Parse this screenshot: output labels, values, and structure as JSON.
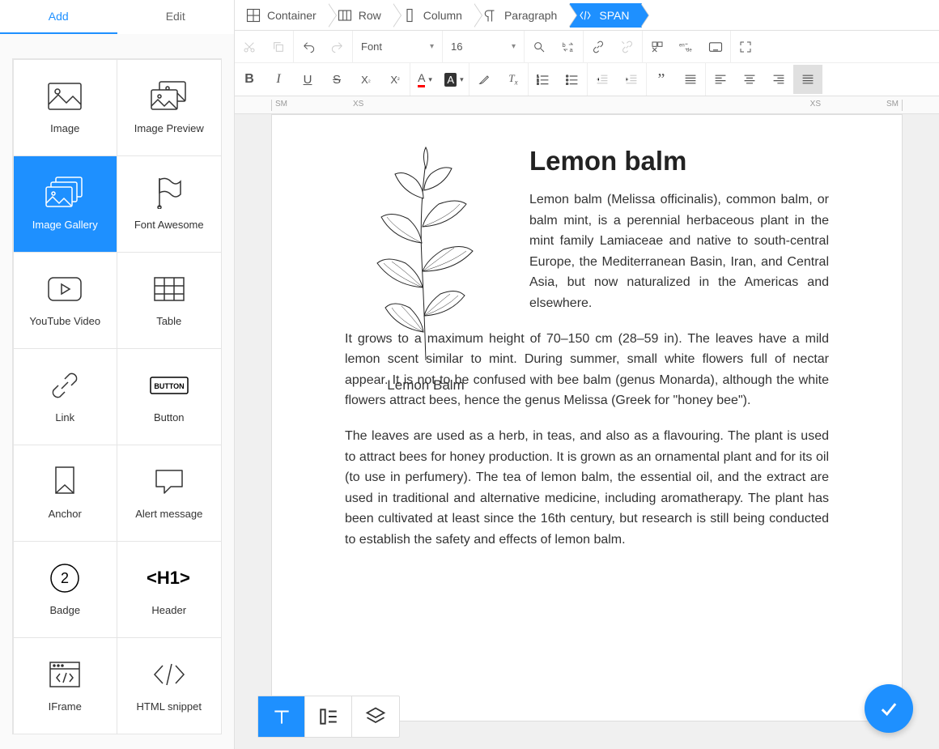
{
  "sidebar": {
    "tabs": {
      "add": "Add",
      "edit": "Edit"
    },
    "tiles": [
      {
        "label": "Image",
        "icon": "image-icon"
      },
      {
        "label": "Image Preview",
        "icon": "image-preview-icon"
      },
      {
        "label": "Image Gallery",
        "icon": "image-gallery-icon",
        "active": true
      },
      {
        "label": "Font Awesome",
        "icon": "flag-icon"
      },
      {
        "label": "YouTube Video",
        "icon": "youtube-icon"
      },
      {
        "label": "Table",
        "icon": "table-icon"
      },
      {
        "label": "Link",
        "icon": "link-icon"
      },
      {
        "label": "Button",
        "icon": "button-icon"
      },
      {
        "label": "Anchor",
        "icon": "anchor-icon"
      },
      {
        "label": "Alert message",
        "icon": "alert-icon"
      },
      {
        "label": "Badge",
        "icon": "badge-icon"
      },
      {
        "label": "Header",
        "icon": "header-icon"
      },
      {
        "label": "IFrame",
        "icon": "iframe-icon"
      },
      {
        "label": "HTML snippet",
        "icon": "html-snippet-icon"
      }
    ]
  },
  "breadcrumb": [
    {
      "label": "Container",
      "icon": "container-icon"
    },
    {
      "label": "Row",
      "icon": "row-icon"
    },
    {
      "label": "Column",
      "icon": "column-icon"
    },
    {
      "label": "Paragraph",
      "icon": "paragraph-icon"
    },
    {
      "label": "SPAN",
      "icon": "span-icon",
      "active": true
    }
  ],
  "toolbar": {
    "font_label": "Font",
    "font_size": "16"
  },
  "ruler": {
    "sm": "SM",
    "xs": "XS"
  },
  "document": {
    "image_caption": "Lemon Balm",
    "title": "Lemon balm",
    "p1": "Lemon balm (Melissa officinalis), common balm, or balm mint, is a perennial herbaceous plant in the mint family Lamiaceae and native to south-central Europe, the Mediterranean Basin, Iran, and Central Asia, but now naturalized in the Americas and elsewhere.",
    "p2": "It grows to a maximum height of 70–150 cm (28–59 in). The leaves have a mild lemon scent similar to mint. During summer, small white flowers full of nectar appear. It is not to be confused with bee balm (genus Monarda), although the white flowers attract bees, hence the genus Melissa (Greek for \"honey bee\").",
    "p3": "The leaves are used as a herb, in teas, and also as a flavouring. The plant is used to attract bees for honey production. It is grown as an ornamental plant and for its oil (to use in perfumery). The tea of lemon balm, the essential oil, and the extract are used in traditional and alternative medicine, including aromatherapy. The plant has been cultivated at least since the 16th century, but research is still being conducted to establish the safety and effects of lemon balm."
  }
}
